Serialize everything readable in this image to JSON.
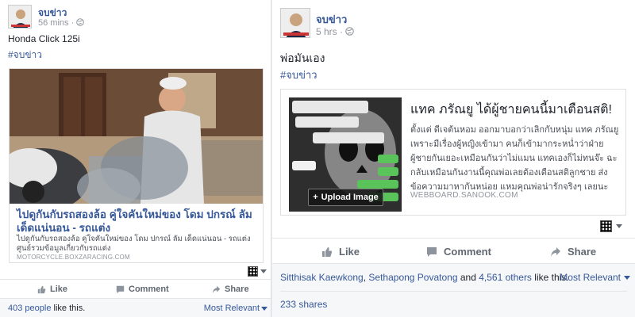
{
  "left_post": {
    "page_name": "จบข่าว",
    "time": "56 mins",
    "text": "Honda Click 125i",
    "hashtag": "#จบข่าว",
    "link_card": {
      "title": "ไปดูกันกับรถสองล้อ คู่ใจคันใหม่ของ โดม ปกรณ์ ลัม เด็ดแน่นอน - รถแต่ง",
      "description": "ไปดูกันกับรถสองล้อ คู่ใจคันใหม่ของ โดม ปกรณ์ ลัม เด็ดแน่นอน - รถแต่ง ศูนย์รวมข้อมูลเกี่ยวกับรถแต่ง",
      "domain": "MOTORCYCLE.BOXZARACING.COM"
    },
    "actions": {
      "like": "Like",
      "comment": "Comment",
      "share": "Share"
    },
    "likes_count": "403 people",
    "likes_suffix": " like this.",
    "sort": "Most Relevant"
  },
  "right_post": {
    "page_name": "จบข่าว",
    "time": "5 hrs",
    "text": "พ่อมันเอง",
    "hashtag": "#จบข่าว",
    "link_card": {
      "title": "แทค ภรัณยู ได้ผู้ชายคนนี้มาเตือนสติ!",
      "description": "ตั้งแต่ ดีเจต้นหอม ออกมาบอกว่าเลิกกับหนุ่ม แทค ภรัณยู เพราะมีเรื่องผู้หญิงเข้ามา คนก็เข้ามากระหน่ำว่าฝ่ายผู้ชายกันเยอะเหมือนกันว่าไม่แมน แทคเองก็ไม่ทนจ๊ะ ฉะกลับเหมือนกันงานนี้คุณพ่อเลยต้องเตือนสติลูกชาย ส่งข้อความมาหากันหน่อย แหมคุณพ่อน่ารักจริงๆ เลยนะ",
      "domain": "WEBBOARD.SANOOK.COM",
      "upload_label": "Upload Image"
    },
    "actions": {
      "like": "Like",
      "comment": "Comment",
      "share": "Share"
    },
    "likers": {
      "name1": "Sitthisak Kaewkong",
      "sep": ", ",
      "name2": "Sethapong Povatong",
      "and": " and ",
      "others": "4,561 others",
      "suffix": " like this."
    },
    "sort": "Most Relevant",
    "shares": "233 shares"
  },
  "colors": {
    "link": "#365899",
    "muted": "#90949c",
    "action": "#606770",
    "footer_bg": "#f6f7f9"
  }
}
